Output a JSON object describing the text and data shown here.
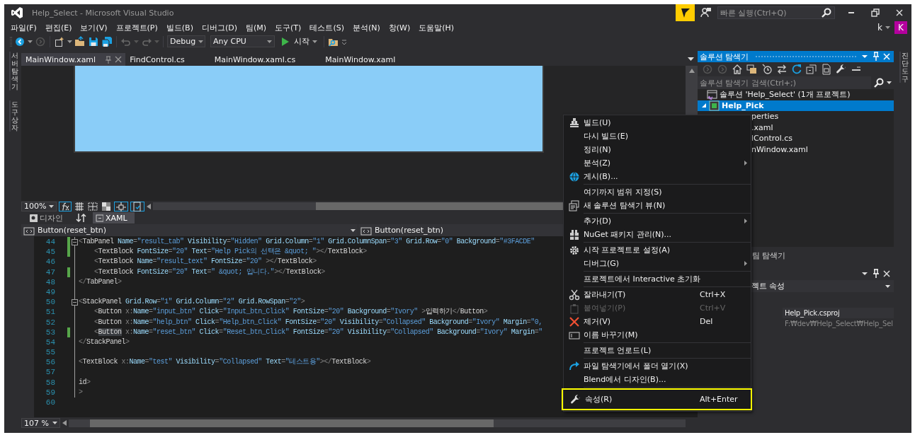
{
  "window": {
    "title": "Help_Select - Microsoft Visual Studio",
    "quick_launch": {
      "placeholder": "빠른 실행(Ctrl+Q)"
    }
  },
  "menu": [
    "파일(F)",
    "편집(E)",
    "보기(V)",
    "프로젝트(P)",
    "빌드(B)",
    "디버그(D)",
    "팀(M)",
    "도구(T)",
    "테스트(S)",
    "분석(N)",
    "창(W)",
    "도움말(H)"
  ],
  "account": {
    "name": "k",
    "initial": "K"
  },
  "toolbar": {
    "configuration": "Debug",
    "platform": "Any CPU",
    "start": "시작"
  },
  "left_dock": [
    "서버 탐색기",
    "도구 상자"
  ],
  "right_dock": [
    "진단 도구"
  ],
  "editor": {
    "tabs": [
      {
        "label": "MainWindow.xaml",
        "selected": true
      },
      {
        "label": "FindControl.cs",
        "selected": false
      },
      {
        "label": "MainWindow.xaml.cs",
        "selected": false
      },
      {
        "label": "MainWindow.xaml",
        "selected": false
      }
    ],
    "design_zoom": "100%",
    "view_tabs": [
      {
        "label": "디자인",
        "selected": false
      },
      {
        "label": "XAML",
        "selected": true
      }
    ],
    "nav": [
      "Button(reset_btn)",
      "Button(reset_btn)"
    ],
    "code": [
      {
        "number": "44",
        "changed": true,
        "fold": true,
        "tokens": [
          {
            "kind": "p",
            "text": "<"
          },
          {
            "kind": "e",
            "text": "TabPanel"
          },
          {
            "kind": "a",
            "text": " Name"
          },
          {
            "kind": "p",
            "text": "="
          },
          {
            "kind": "v",
            "text": "\"result_tab\""
          },
          {
            "kind": "a",
            "text": " Visibility"
          },
          {
            "kind": "p",
            "text": "="
          },
          {
            "kind": "v",
            "text": "\"Hidden\""
          },
          {
            "kind": "a",
            "text": " Grid.Column"
          },
          {
            "kind": "p",
            "text": "="
          },
          {
            "kind": "v",
            "text": "\"1\""
          },
          {
            "kind": "a",
            "text": " Grid.ColumnSpan"
          },
          {
            "kind": "p",
            "text": "="
          },
          {
            "kind": "v",
            "text": "\"3\""
          },
          {
            "kind": "a",
            "text": " Grid.Row"
          },
          {
            "kind": "p",
            "text": "="
          },
          {
            "kind": "v",
            "text": "\"0\""
          },
          {
            "kind": "a",
            "text": " Background"
          },
          {
            "kind": "p",
            "text": "="
          },
          {
            "kind": "v",
            "text": "\"#3FACDE\""
          }
        ]
      },
      {
        "number": "45",
        "changed": true,
        "fold": false,
        "tokens": [
          {
            "kind": "p",
            "text": "    <"
          },
          {
            "kind": "e",
            "text": "TextBlock"
          },
          {
            "kind": "a",
            "text": " FontSize"
          },
          {
            "kind": "p",
            "text": "="
          },
          {
            "kind": "v",
            "text": "\"20\""
          },
          {
            "kind": "a",
            "text": " Text"
          },
          {
            "kind": "p",
            "text": "="
          },
          {
            "kind": "v",
            "text": "\"Help Pick의 선택은 &quot; \""
          },
          {
            "kind": "p",
            "text": "></"
          },
          {
            "kind": "e",
            "text": "TextBlock"
          },
          {
            "kind": "p",
            "text": ">"
          }
        ]
      },
      {
        "number": "46",
        "changed": false,
        "fold": false,
        "tokens": [
          {
            "kind": "p",
            "text": "    <"
          },
          {
            "kind": "e",
            "text": "TextBlock"
          },
          {
            "kind": "a",
            "text": " Name"
          },
          {
            "kind": "p",
            "text": "="
          },
          {
            "kind": "v",
            "text": "\"result_text\""
          },
          {
            "kind": "a",
            "text": " FontSize"
          },
          {
            "kind": "p",
            "text": "="
          },
          {
            "kind": "v",
            "text": "\"20\""
          },
          {
            "kind": "p",
            "text": " ></"
          },
          {
            "kind": "e",
            "text": "TextBlock"
          },
          {
            "kind": "p",
            "text": ">"
          }
        ]
      },
      {
        "number": "47",
        "changed": true,
        "fold": false,
        "tokens": [
          {
            "kind": "p",
            "text": "    <"
          },
          {
            "kind": "e",
            "text": "TextBlock"
          },
          {
            "kind": "a",
            "text": " FontSize"
          },
          {
            "kind": "p",
            "text": "="
          },
          {
            "kind": "v",
            "text": "\"20\""
          },
          {
            "kind": "a",
            "text": " Text"
          },
          {
            "kind": "p",
            "text": "="
          },
          {
            "kind": "v",
            "text": "\" &quot; 입니다.\""
          },
          {
            "kind": "p",
            "text": "></"
          },
          {
            "kind": "e",
            "text": "TextBlock"
          },
          {
            "kind": "p",
            "text": ">"
          }
        ]
      },
      {
        "number": "48",
        "changed": false,
        "fold": false,
        "tokens": [
          {
            "kind": "p",
            "text": "</"
          },
          {
            "kind": "e",
            "text": "TabPanel"
          },
          {
            "kind": "p",
            "text": ">"
          }
        ]
      },
      {
        "number": "49",
        "changed": false,
        "fold": false
      },
      {
        "number": "50",
        "changed": false,
        "fold": true,
        "tokens": [
          {
            "kind": "p",
            "text": "<"
          },
          {
            "kind": "e",
            "text": "StackPanel"
          },
          {
            "kind": "a",
            "text": " Grid.Row"
          },
          {
            "kind": "p",
            "text": "="
          },
          {
            "kind": "v",
            "text": "\"1\""
          },
          {
            "kind": "a",
            "text": " Grid.Column"
          },
          {
            "kind": "p",
            "text": "="
          },
          {
            "kind": "v",
            "text": "\"2\""
          },
          {
            "kind": "a",
            "text": " Grid.RowSpan"
          },
          {
            "kind": "p",
            "text": "="
          },
          {
            "kind": "v",
            "text": "\"2\""
          },
          {
            "kind": "p",
            "text": ">"
          }
        ]
      },
      {
        "number": "51",
        "changed": false,
        "fold": false,
        "tokens": [
          {
            "kind": "p",
            "text": "    <"
          },
          {
            "kind": "e",
            "text": "Button"
          },
          {
            "kind": "p",
            "text": " x:"
          },
          {
            "kind": "a",
            "text": "Name"
          },
          {
            "kind": "p",
            "text": "="
          },
          {
            "kind": "v",
            "text": "\"input_btn\""
          },
          {
            "kind": "a",
            "text": " Click"
          },
          {
            "kind": "p",
            "text": "="
          },
          {
            "kind": "v",
            "text": "\"Input_btn_Click\""
          },
          {
            "kind": "a",
            "text": " FontSize"
          },
          {
            "kind": "p",
            "text": "="
          },
          {
            "kind": "v",
            "text": "\"20\""
          },
          {
            "kind": "a",
            "text": " Background"
          },
          {
            "kind": "p",
            "text": "="
          },
          {
            "kind": "v",
            "text": "\"Ivory\""
          },
          {
            "kind": "p",
            "text": " >"
          },
          {
            "kind": "x",
            "text": "입력하기"
          },
          {
            "kind": "p",
            "text": "</"
          },
          {
            "kind": "e",
            "text": "Button"
          },
          {
            "kind": "p",
            "text": ">"
          }
        ]
      },
      {
        "number": "52",
        "changed": false,
        "fold": false,
        "tokens": [
          {
            "kind": "p",
            "text": "    <"
          },
          {
            "kind": "e",
            "text": "Button"
          },
          {
            "kind": "p",
            "text": " x:"
          },
          {
            "kind": "a",
            "text": "Name"
          },
          {
            "kind": "p",
            "text": "="
          },
          {
            "kind": "v",
            "text": "\"help_btn\""
          },
          {
            "kind": "a",
            "text": " Click"
          },
          {
            "kind": "p",
            "text": "="
          },
          {
            "kind": "v",
            "text": "\"Help_btn_Click\""
          },
          {
            "kind": "a",
            "text": " FontSize"
          },
          {
            "kind": "p",
            "text": "="
          },
          {
            "kind": "v",
            "text": "\"20\""
          },
          {
            "kind": "a",
            "text": " Visibility"
          },
          {
            "kind": "p",
            "text": "="
          },
          {
            "kind": "v",
            "text": "\"Collapsed\""
          },
          {
            "kind": "a",
            "text": " Background"
          },
          {
            "kind": "p",
            "text": "="
          },
          {
            "kind": "v",
            "text": "\"Ivory\""
          },
          {
            "kind": "a",
            "text": " Margin"
          },
          {
            "kind": "p",
            "text": "="
          },
          {
            "kind": "v",
            "text": "\"0,"
          }
        ]
      },
      {
        "number": "53",
        "changed": true,
        "fold": false,
        "tokens": [
          {
            "kind": "p",
            "text": "    <"
          },
          {
            "kind": "h",
            "text": "Button"
          },
          {
            "kind": "p",
            "text": " x:"
          },
          {
            "kind": "a",
            "text": "Name"
          },
          {
            "kind": "p",
            "text": "="
          },
          {
            "kind": "v",
            "text": "\"reset_btn\""
          },
          {
            "kind": "a",
            "text": " Click"
          },
          {
            "kind": "p",
            "text": "="
          },
          {
            "kind": "v",
            "text": "\"Reset_btn_Click\""
          },
          {
            "kind": "a",
            "text": " FontSize"
          },
          {
            "kind": "p",
            "text": "="
          },
          {
            "kind": "v",
            "text": "\"20\""
          },
          {
            "kind": "a",
            "text": " Visibility"
          },
          {
            "kind": "p",
            "text": "="
          },
          {
            "kind": "v",
            "text": "\"Collapsed\""
          },
          {
            "kind": "a",
            "text": " Background"
          },
          {
            "kind": "p",
            "text": "="
          },
          {
            "kind": "v",
            "text": "\"Ivory\""
          },
          {
            "kind": "a",
            "text": " Margin"
          },
          {
            "kind": "p",
            "text": "="
          },
          {
            "kind": "v",
            "text": "\""
          }
        ]
      },
      {
        "number": "54",
        "changed": false,
        "fold": false,
        "tokens": [
          {
            "kind": "p",
            "text": "</"
          },
          {
            "kind": "e",
            "text": "StackPanel"
          },
          {
            "kind": "p",
            "text": ">"
          }
        ]
      },
      {
        "number": "55",
        "changed": false,
        "fold": false
      },
      {
        "number": "56",
        "changed": false,
        "fold": false,
        "tokens": [
          {
            "kind": "p",
            "text": "<"
          },
          {
            "kind": "e",
            "text": "TextBlock"
          },
          {
            "kind": "p",
            "text": " x:"
          },
          {
            "kind": "a",
            "text": "Name"
          },
          {
            "kind": "p",
            "text": "="
          },
          {
            "kind": "v",
            "text": "\"test\""
          },
          {
            "kind": "a",
            "text": " Visibility"
          },
          {
            "kind": "p",
            "text": "="
          },
          {
            "kind": "v",
            "text": "\"Collapsed\""
          },
          {
            "kind": "a",
            "text": " Text"
          },
          {
            "kind": "p",
            "text": "="
          },
          {
            "kind": "v",
            "text": "\"테스트용\""
          },
          {
            "kind": "p",
            "text": "></"
          },
          {
            "kind": "e",
            "text": "TextBlock"
          },
          {
            "kind": "p",
            "text": ">"
          }
        ]
      },
      {
        "number": "57",
        "changed": false,
        "fold": false
      },
      {
        "number": "58",
        "changed": false,
        "fold": false,
        "tokens": [
          {
            "kind": "e",
            "text": "id"
          },
          {
            "kind": "p",
            "text": ">"
          }
        ]
      },
      {
        "number": "59",
        "changed": false,
        "fold": false,
        "tokens": [
          {
            "kind": "p",
            "text": ">"
          }
        ]
      },
      {
        "number": "60",
        "changed": false,
        "fold": false
      }
    ],
    "code_zoom": "107 %"
  },
  "solution_explorer": {
    "title": "솔루션 탐색기",
    "search": {
      "placeholder": "솔루션 탐색기 검색(Ctrl+;)"
    },
    "tree": [
      {
        "label": "솔루션 'Help_Select' (1개 프로젝트)",
        "selected": false,
        "children": [
          {
            "label": "Help_Pick",
            "selected": true,
            "expanded": true,
            "children": [
              {
                "label": "perties",
                "selected": false
              },
              {
                "label": ".xaml",
                "selected": false
              },
              {
                "label": "lControl.cs",
                "selected": false
              },
              {
                "label": "nWindow.xaml",
                "selected": false
              }
            ]
          }
        ]
      }
    ]
  },
  "team_tab": "팀 탐색기",
  "properties": {
    "object": "젝트 속성",
    "rows": [
      {
        "value": "Help_Pick.csproj",
        "readonly": false
      },
      {
        "value": "F:₩dev₩Help_Select₩Help_Sel",
        "readonly": true
      }
    ]
  },
  "context_menu": [
    {
      "kind": "item",
      "label": "빌드(U)",
      "disabled": false,
      "submenu": false,
      "highlighted": false
    },
    {
      "kind": "item",
      "label": "다시 빌드(E)",
      "disabled": false,
      "submenu": false,
      "highlighted": false
    },
    {
      "kind": "item",
      "label": "정리(N)",
      "disabled": false,
      "submenu": false,
      "highlighted": false
    },
    {
      "kind": "item",
      "label": "분석(Z)",
      "disabled": false,
      "submenu": true,
      "highlighted": false
    },
    {
      "kind": "item",
      "label": "게시(B)...",
      "disabled": false,
      "submenu": false,
      "highlighted": false
    },
    {
      "kind": "separator"
    },
    {
      "kind": "item",
      "label": "여기까지 범위 지정(S)",
      "disabled": false,
      "submenu": false,
      "highlighted": false
    },
    {
      "kind": "item",
      "label": "새 솔루션 탐색기 뷰(N)",
      "disabled": false,
      "submenu": false,
      "highlighted": false
    },
    {
      "kind": "separator"
    },
    {
      "kind": "item",
      "label": "추가(D)",
      "disabled": false,
      "submenu": true,
      "highlighted": false
    },
    {
      "kind": "item",
      "label": "NuGet 패키지 관리(N)...",
      "disabled": false,
      "submenu": false,
      "highlighted": false
    },
    {
      "kind": "separator"
    },
    {
      "kind": "item",
      "label": "시작 프로젝트로 설정(A)",
      "disabled": false,
      "submenu": false,
      "highlighted": false
    },
    {
      "kind": "item",
      "label": "디버그(G)",
      "disabled": false,
      "submenu": true,
      "highlighted": false
    },
    {
      "kind": "separator"
    },
    {
      "kind": "item",
      "label": "프로젝트에서 Interactive 초기화",
      "disabled": false,
      "submenu": false,
      "highlighted": false
    },
    {
      "kind": "separator"
    },
    {
      "kind": "item",
      "label": "잘라내기(T)",
      "shortcut": "Ctrl+X",
      "disabled": false,
      "submenu": false,
      "highlighted": false
    },
    {
      "kind": "item",
      "label": "붙여넣기(P)",
      "shortcut": "Ctrl+V",
      "disabled": true,
      "submenu": false,
      "highlighted": false
    },
    {
      "kind": "item",
      "label": "제거(V)",
      "shortcut": "Del",
      "disabled": false,
      "submenu": false,
      "highlighted": false
    },
    {
      "kind": "item",
      "label": "이름 바꾸기(M)",
      "disabled": false,
      "submenu": false,
      "highlighted": false
    },
    {
      "kind": "separator"
    },
    {
      "kind": "item",
      "label": "프로젝트 언로드(L)",
      "disabled": false,
      "submenu": false,
      "highlighted": false
    },
    {
      "kind": "separator"
    },
    {
      "kind": "item",
      "label": "파일 탐색기에서 폴더 열기(X)",
      "disabled": false,
      "submenu": false,
      "highlighted": false
    },
    {
      "kind": "item",
      "label": "Blend에서 디자인(B)...",
      "disabled": false,
      "submenu": false,
      "highlighted": false
    },
    {
      "kind": "separator"
    },
    {
      "kind": "item",
      "label": "속성(R)",
      "shortcut": "Alt+Enter",
      "disabled": false,
      "submenu": false,
      "highlighted": true
    }
  ]
}
